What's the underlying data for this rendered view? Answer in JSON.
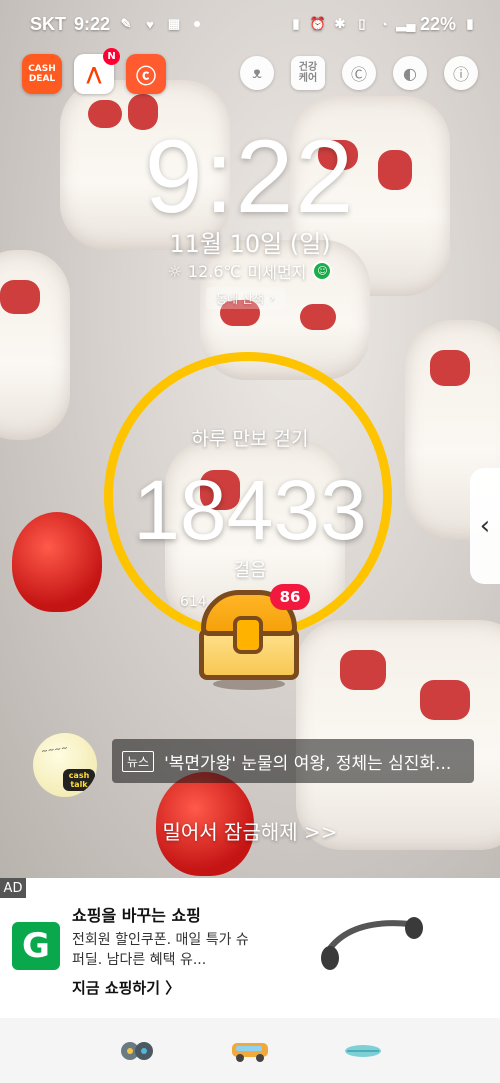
{
  "status_bar": {
    "carrier": "SKT",
    "time": "9:22",
    "battery": "22%",
    "icons": [
      "feather-icon",
      "heart-app-icon",
      "calendar-app-icon",
      "battery-saver-icon",
      "alarm-icon",
      "bluetooth-icon",
      "vibrate-icon",
      "wifi-icon",
      "signal-icon"
    ]
  },
  "top_apps": {
    "cash_deal": "CASH\nDEAL",
    "news_badge": "N",
    "icons": [
      "cashdeal-app-icon",
      "notification-app-icon",
      "dog-app-icon"
    ]
  },
  "tools": {
    "health_label": "건강\n케어",
    "icons": [
      "cat-icon",
      "health-care-icon",
      "c-coin-icon",
      "pill-icon",
      "info-icon"
    ]
  },
  "lockscreen": {
    "time": "9:22",
    "date": "11월 10일 (일)",
    "weather_temp": "12.6℃",
    "weather_dust": "미세먼지",
    "walk_button": "동네 산책"
  },
  "pedometer": {
    "title": "하루 만보 걷기",
    "steps": "18433",
    "unit": "걸음",
    "distance_prefix": "614",
    "distance_suffix": "m",
    "chest_badge": "86",
    "ring_color": "#ffc400"
  },
  "news": {
    "label": "뉴스",
    "headline": "'복면가왕' 눈물의 여왕, 정체는 심진화..."
  },
  "cashtalk": {
    "tag": "cash\ntalk"
  },
  "unlock_text": "밀어서 잠금해제 >>",
  "ad": {
    "tag": "AD",
    "logo": "G",
    "title": "쇼핑을 바꾸는 쇼핑",
    "description": "전회원 할인쿠폰. 매일 특가 슈퍼딜. 남다른 혜택 유...",
    "cta": "지금 쇼핑하기 〉"
  },
  "bottom_bar": {
    "icons": [
      "disc-icon",
      "van-icon",
      "surfboard-icon"
    ]
  }
}
